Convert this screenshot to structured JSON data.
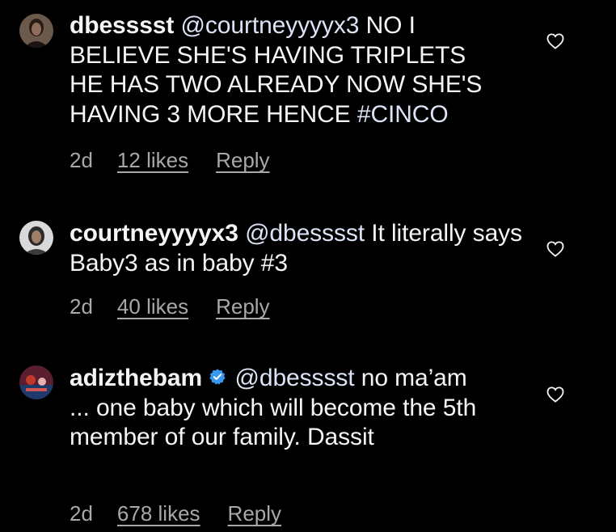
{
  "comments": [
    {
      "username": "dbesssst",
      "mention": "@courtneyyyyx3",
      "text_1": "NO I BELIEVE SHE'S HAVING TRIPLETS HE HAS TWO ALREADY NOW SHE'S HAVING 3 MORE HENCE",
      "hashtag": "#CINCO",
      "time": "2d",
      "likes": "12 likes",
      "reply": "Reply"
    },
    {
      "username": "courtneyyyyx3",
      "mention": "@dbesssst",
      "text_1": "It literally says Baby3 as in baby #3",
      "time": "2d",
      "likes": "40 likes",
      "reply": "Reply"
    },
    {
      "username": "adizthebam",
      "verified": true,
      "mention": "@dbesssst",
      "text_1": "no ma’am ... one baby which will become the 5th member of our family. Dassit",
      "time": "2d",
      "likes": "678 likes",
      "reply": "Reply"
    }
  ],
  "colors": {
    "background": "#000000",
    "text": "#f5f5f5",
    "secondary": "#a8a8a8",
    "verified": "#3897f0"
  },
  "icons": [
    "heart-icon",
    "verified-badge-icon"
  ]
}
